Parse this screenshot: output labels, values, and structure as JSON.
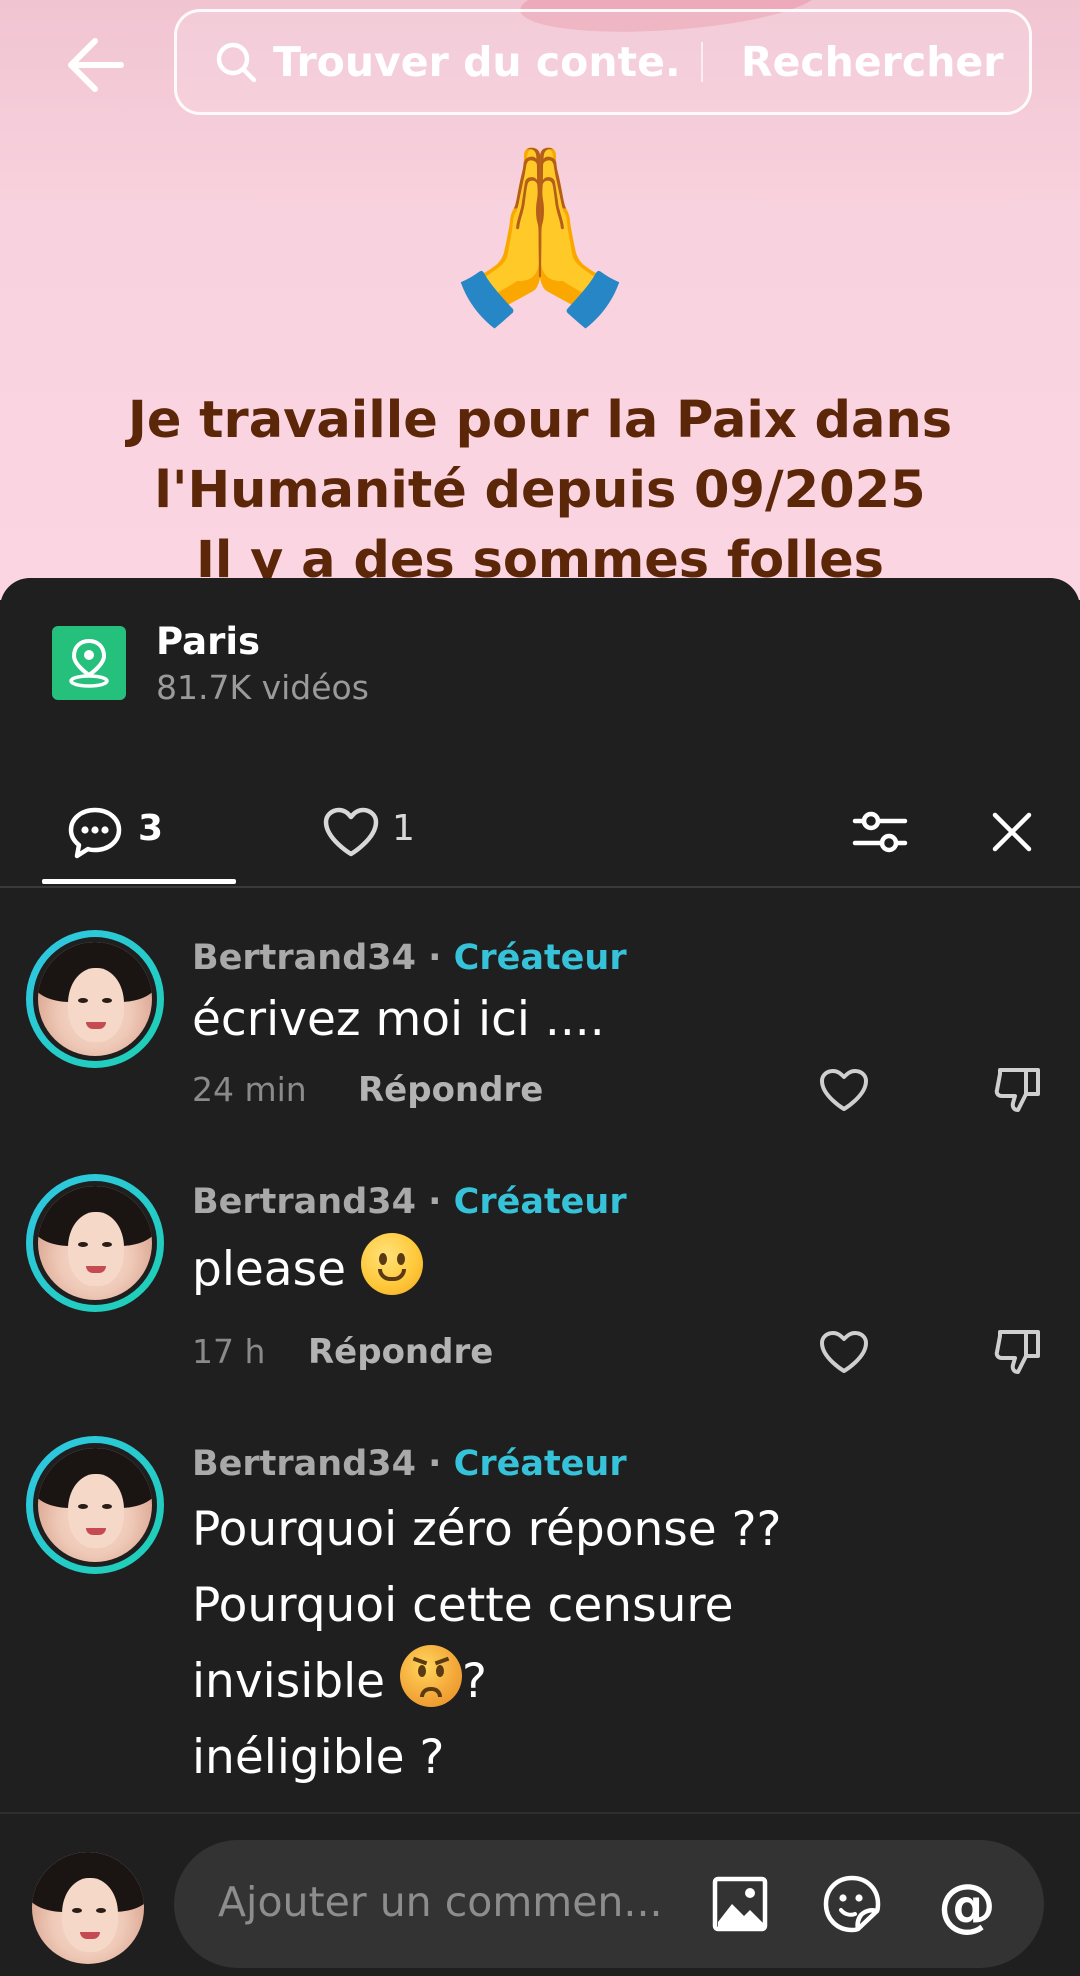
{
  "video": {
    "emoji": "🙏",
    "caption_lines": [
      "Je travaille pour la Paix dans",
      "l'Humanité depuis 09/2025",
      "Il y a des sommes folles"
    ]
  },
  "search": {
    "placeholder": "Trouver du conte...",
    "button_label": "Rechercher"
  },
  "location": {
    "name": "Paris",
    "count": "81.7K vidéos"
  },
  "tabs": {
    "comments_count": "3",
    "likes_count": "1"
  },
  "comments": [
    {
      "user": "Bertrand34",
      "separator": "·",
      "badge": "Créateur",
      "text": "écrivez moi ici ....",
      "time": "24 min",
      "reply": "Répondre"
    },
    {
      "user": "Bertrand34",
      "separator": "·",
      "badge": "Créateur",
      "text": "please",
      "time": "17 h",
      "reply": "Répondre"
    },
    {
      "user": "Bertrand34",
      "separator": "·",
      "badge": "Créateur",
      "lines": [
        "Pourquoi zéro réponse ??",
        "Pourquoi cette censure",
        "invisible",
        "?",
        "inéligible ?"
      ]
    }
  ],
  "composer": {
    "placeholder": "Ajouter un commen...",
    "at_symbol": "@"
  },
  "icons": {
    "back": "arrow-left-icon",
    "search": "search-icon",
    "location": "location-pin-icon",
    "comments": "comment-bubble-icon",
    "likes": "heart-icon",
    "filter": "sliders-icon",
    "close": "close-icon",
    "like": "heart-outline-icon",
    "dislike": "thumbs-down-icon",
    "image": "image-icon",
    "sticker": "sticker-icon"
  },
  "colors": {
    "accent_badge": "#36c3da",
    "location_green": "#25c07c",
    "panel_bg": "#1f1f1f",
    "caption": "#5c2708"
  }
}
